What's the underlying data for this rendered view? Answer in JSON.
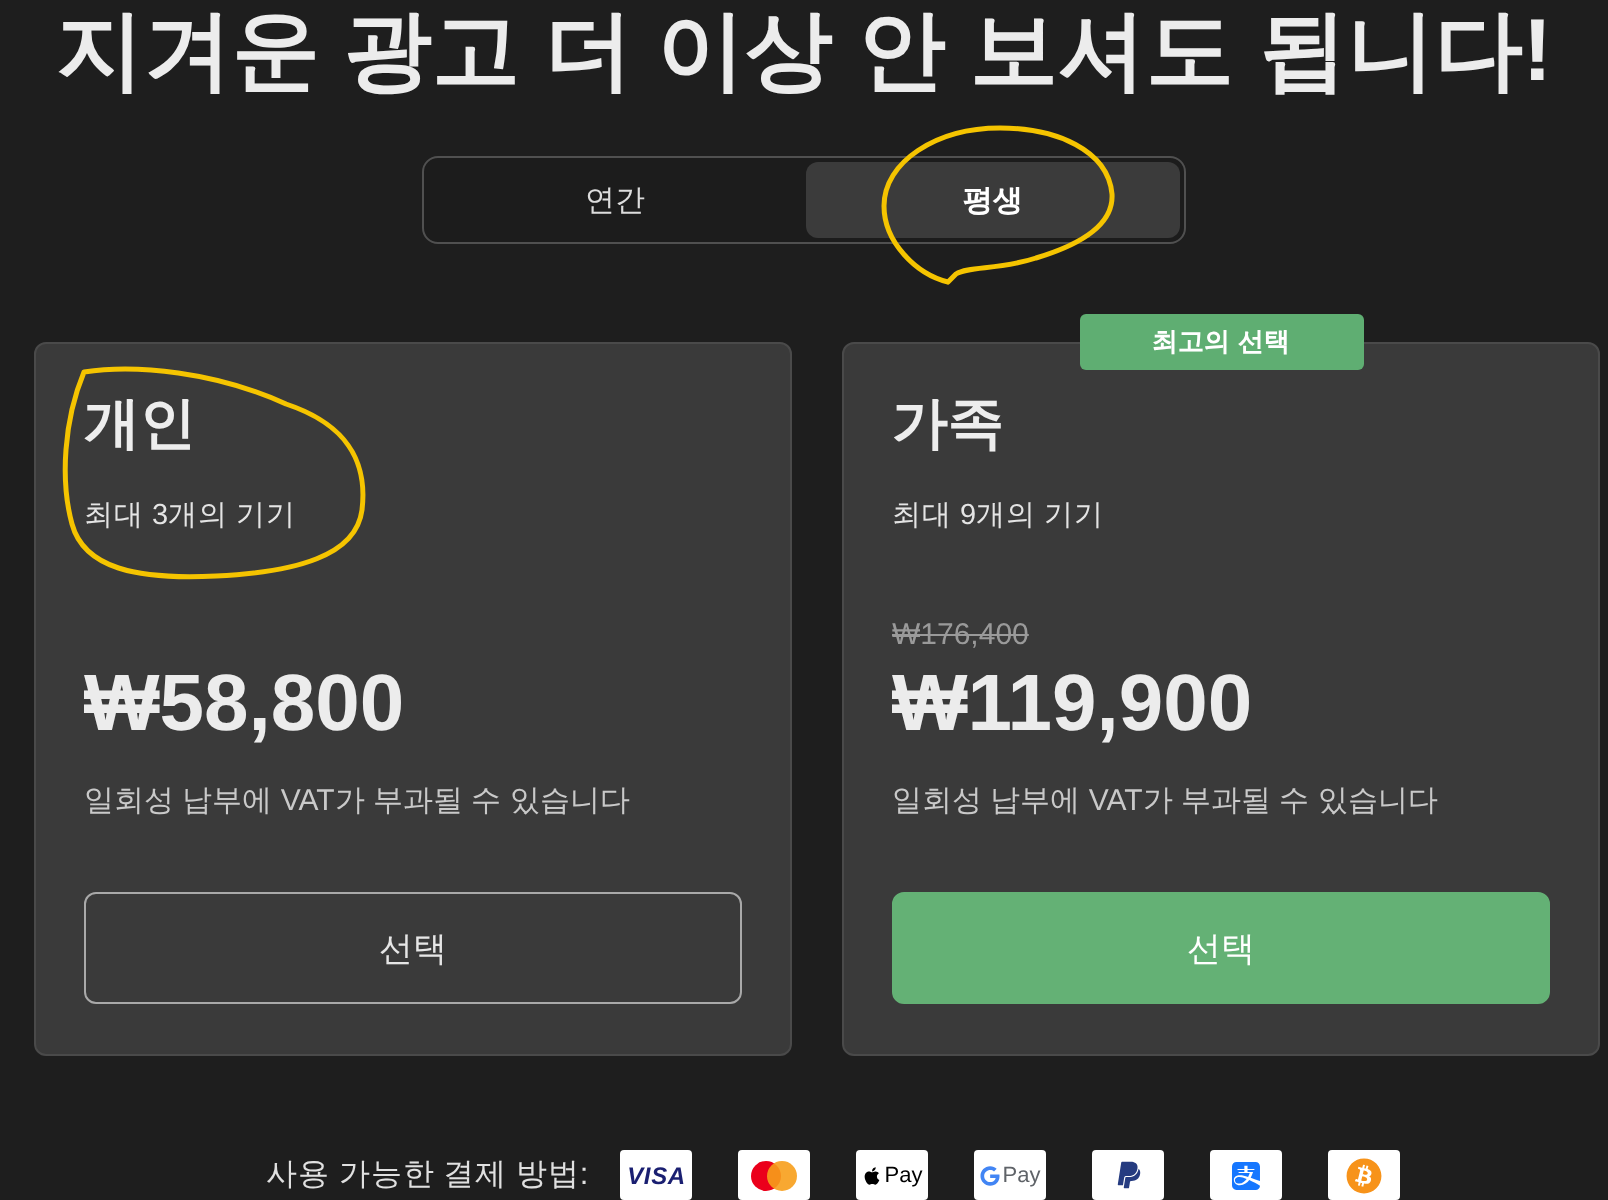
{
  "headline": "지겨운 광고 더 이상 안 보셔도 됩니다!",
  "billing_toggle": [
    {
      "label": "연간",
      "selected": false
    },
    {
      "label": "평생",
      "selected": true
    }
  ],
  "plans": [
    {
      "name": "개인",
      "devices": "최대 3개의 기기",
      "price": "₩58,800",
      "note": "일회성 납부에 VAT가 부과될 수 있습니다",
      "button": "선택",
      "featured": false
    },
    {
      "name": "가족",
      "badge": "최고의 선택",
      "devices": "최대 9개의 기기",
      "original_price": "₩176,400",
      "price": "₩119,900",
      "note": "일회성 납부에 VAT가 부과될 수 있습니다",
      "button": "선택",
      "featured": true
    }
  ],
  "payment": {
    "label": "사용 가능한 결제 방법:",
    "methods": [
      {
        "kind": "visa",
        "text": "VISA"
      },
      {
        "kind": "mastercard"
      },
      {
        "kind": "apple_pay",
        "text": "Pay"
      },
      {
        "kind": "google_pay",
        "text": "Pay"
      },
      {
        "kind": "paypal"
      },
      {
        "kind": "alipay"
      },
      {
        "kind": "bitcoin"
      }
    ]
  }
}
